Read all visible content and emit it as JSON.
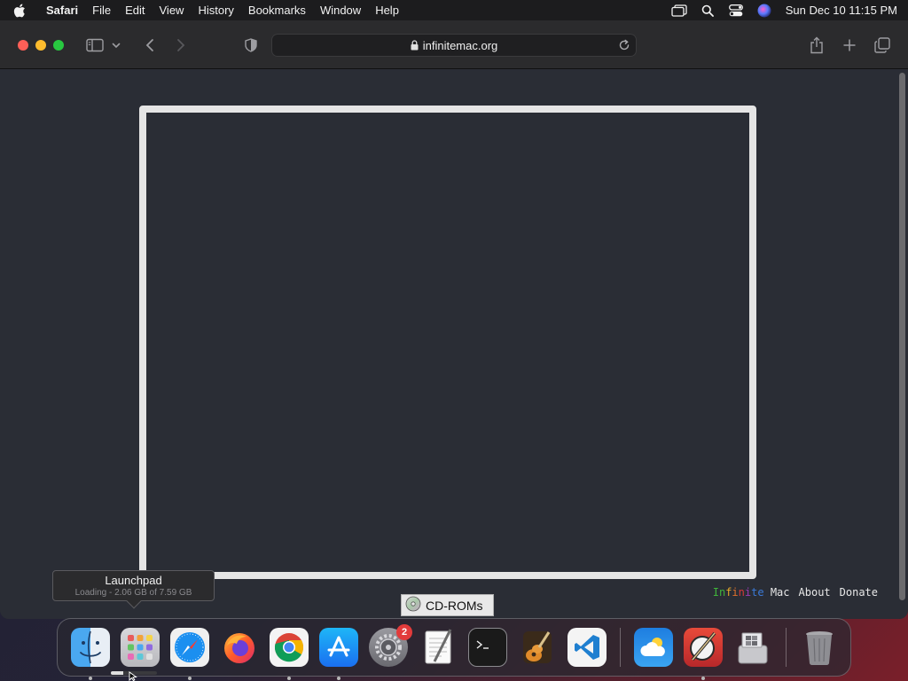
{
  "menubar": {
    "app_name": "Safari",
    "items": [
      "File",
      "Edit",
      "View",
      "History",
      "Bookmarks",
      "Window",
      "Help"
    ],
    "clock": "Sun Dec 10  11:15 PM",
    "icons": [
      "stage-manager-icon",
      "spotlight-search-icon",
      "control-center-icon",
      "siri-icon"
    ]
  },
  "browser": {
    "url": "infinitemac.org",
    "tab_icons": [
      "sidebar-icon",
      "chevron-down-icon",
      "back-icon",
      "forward-icon",
      "privacy-shield-icon",
      "share-icon",
      "new-tab-icon",
      "tab-overview-icon"
    ]
  },
  "page": {
    "brand_letters": [
      "I",
      "n",
      "f",
      "i",
      "n",
      "i",
      "t",
      "e"
    ],
    "brand_suffix": "Mac",
    "about_label": "About",
    "donate_label": "Donate"
  },
  "tooltip": {
    "title": "Launchpad",
    "subtitle": "Loading - 2.06 GB of 7.59 GB",
    "progress_fraction": 0.271
  },
  "cdrom": {
    "label": "CD-ROMs"
  },
  "dock": {
    "apps": [
      {
        "name": "Finder",
        "icon": "finder-icon",
        "running": true
      },
      {
        "name": "Launchpad",
        "icon": "launchpad-icon",
        "running": false
      },
      {
        "name": "Safari",
        "icon": "safari-icon",
        "running": true
      },
      {
        "name": "Firefox",
        "icon": "firefox-icon",
        "running": false
      },
      {
        "name": "Chrome",
        "icon": "chrome-icon",
        "running": true
      },
      {
        "name": "App Store",
        "icon": "app-store-icon",
        "running": true
      },
      {
        "name": "System Preferences",
        "icon": "system-preferences-icon",
        "running": false,
        "badge": "2"
      },
      {
        "name": "TextEdit",
        "icon": "textedit-icon",
        "running": false
      },
      {
        "name": "Terminal",
        "icon": "terminal-icon",
        "running": false
      },
      {
        "name": "GarageBand",
        "icon": "garageband-icon",
        "running": false
      },
      {
        "name": "Visual Studio Code",
        "icon": "vscode-icon",
        "running": false
      }
    ],
    "extras": [
      {
        "name": "Weather",
        "icon": "weather-icon",
        "running": false
      },
      {
        "name": "Compass",
        "icon": "compass-icon",
        "running": true
      },
      {
        "name": "Boot Camp",
        "icon": "bootcamp-icon",
        "running": false
      }
    ],
    "trash": {
      "name": "Trash",
      "icon": "trash-icon"
    }
  }
}
